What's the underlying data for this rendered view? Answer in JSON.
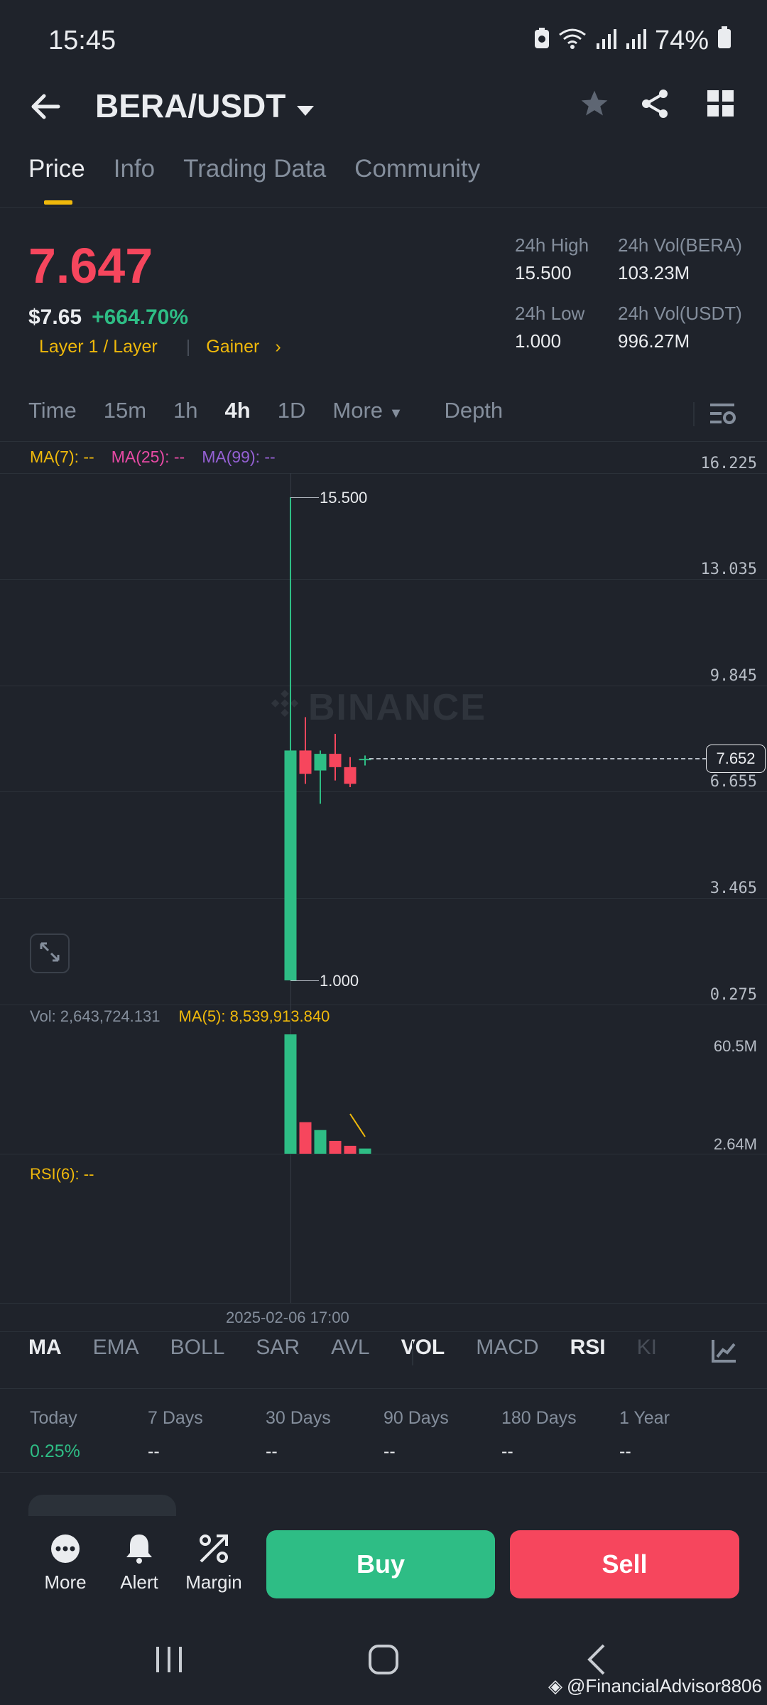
{
  "status": {
    "time": "15:45",
    "battery": "74%"
  },
  "header": {
    "pair": "BERA/USDT"
  },
  "tabs": [
    "Price",
    "Info",
    "Trading Data",
    "Community"
  ],
  "price": {
    "last": "7.647",
    "usd": "$7.65",
    "change": "+664.70%",
    "tag1": "Layer 1 / Layer",
    "tag2": "Gainer",
    "high_label": "24h High",
    "high": "15.500",
    "low_label": "24h Low",
    "low": "1.000",
    "vol_base_label": "24h Vol(BERA)",
    "vol_base": "103.23M",
    "vol_quote_label": "24h Vol(USDT)",
    "vol_quote": "996.27M"
  },
  "intervals": [
    "Time",
    "15m",
    "1h",
    "4h",
    "1D",
    "More",
    "Depth"
  ],
  "chart": {
    "ma7": "MA(7): --",
    "ma25": "MA(25): --",
    "ma99": "MA(99): --",
    "watermark": "BINANCE",
    "y_ticks": [
      "16.225",
      "13.035",
      "9.845",
      "6.655",
      "3.465",
      "0.275"
    ],
    "high_mark": "15.500",
    "low_mark": "1.000",
    "current": "7.652",
    "vol_label": "Vol: 2,643,724.131",
    "vol_ma": "MA(5): 8,539,913.840",
    "vol_ticks": [
      "60.5M",
      "2.64M"
    ],
    "rsi": "RSI(6): --",
    "x_label": "2025-02-06 17:00"
  },
  "chart_data": {
    "type": "candlestick",
    "series": [
      {
        "open": 1.0,
        "high": 15.5,
        "low": 1.0,
        "close": 7.9,
        "color": "#2ebd85"
      },
      {
        "open": 7.9,
        "high": 8.9,
        "low": 6.9,
        "close": 7.2,
        "color": "#f6465d"
      },
      {
        "open": 7.3,
        "high": 7.9,
        "low": 6.3,
        "close": 7.8,
        "color": "#2ebd85"
      },
      {
        "open": 7.8,
        "high": 8.4,
        "low": 7.0,
        "close": 7.4,
        "color": "#f6465d"
      },
      {
        "open": 7.4,
        "high": 7.7,
        "low": 6.8,
        "close": 6.9,
        "color": "#f6465d"
      },
      {
        "open": 7.64,
        "high": 7.75,
        "low": 7.45,
        "close": 7.65,
        "color": "#2ebd85"
      }
    ],
    "volumes": [
      60.5,
      16.0,
      12.0,
      6.5,
      4.0,
      2.64
    ],
    "ylim": [
      0.275,
      16.225
    ],
    "vol_max": 60.5
  },
  "indicators": [
    "MA",
    "EMA",
    "BOLL",
    "SAR",
    "AVL",
    "VOL",
    "MACD",
    "RSI",
    "KI"
  ],
  "performance": [
    {
      "label": "Today",
      "value": "0.25%"
    },
    {
      "label": "7 Days",
      "value": "--"
    },
    {
      "label": "30 Days",
      "value": "--"
    },
    {
      "label": "90 Days",
      "value": "--"
    },
    {
      "label": "180 Days",
      "value": "--"
    },
    {
      "label": "1 Year",
      "value": "--"
    }
  ],
  "bottom": {
    "more": "More",
    "alert": "Alert",
    "margin": "Margin",
    "buy": "Buy",
    "sell": "Sell"
  },
  "credit": "@FinancialAdvisor8806",
  "colors": {
    "up": "#2ebd85",
    "down": "#f6465d",
    "accent": "#f0b90b"
  }
}
